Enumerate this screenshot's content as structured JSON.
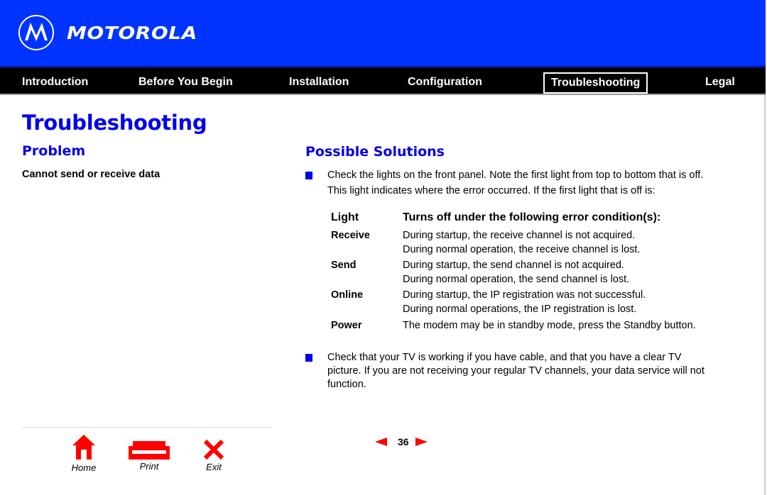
{
  "brand": {
    "name": "MOTOROLA",
    "logo_icon": "motorola-batwing-logo",
    "colors": {
      "brand_blue": "#0033ff",
      "nav_black": "#000000",
      "heading_blue": "#0000ee",
      "icon_red": "#ff0000"
    }
  },
  "nav": {
    "items": [
      {
        "label": "Introduction",
        "active": false
      },
      {
        "label": "Before You Begin",
        "active": false
      },
      {
        "label": "Installation",
        "active": false
      },
      {
        "label": "Configuration",
        "active": false
      },
      {
        "label": "Troubleshooting",
        "active": true
      },
      {
        "label": "Legal",
        "active": false
      }
    ]
  },
  "page": {
    "title": "Troubleshooting",
    "problem_heading": "Problem",
    "problem_text": "Cannot send or receive data",
    "solutions_heading": "Possible Solutions",
    "solutions": [
      {
        "lines": [
          "Check the lights on the front panel. Note the first light from top to bottom that is off.",
          "This light indicates where the error occurred. If the first light that is off is:"
        ]
      },
      {
        "lines": [
          "Check that your TV is working if you have cable, and that you have a clear TV",
          "picture. If you are not receiving your regular TV channels, your data service will not",
          "function."
        ]
      }
    ],
    "light_table": {
      "headers": [
        "Light",
        "Turns off under the following error condition(s):"
      ],
      "rows": [
        {
          "light": "Receive",
          "conditions": [
            "During startup, the receive channel is not acquired.",
            "During normal operation, the receive channel is lost."
          ]
        },
        {
          "light": "Send",
          "conditions": [
            "During startup, the send channel is not acquired.",
            "During normal operation, the send channel is lost."
          ]
        },
        {
          "light": "Online",
          "conditions": [
            "During startup, the IP registration was not successful.",
            "During normal operations, the IP registration is lost."
          ]
        },
        {
          "light": "Power",
          "conditions": [
            "The modem may be in standby mode, press the Standby button."
          ]
        }
      ]
    }
  },
  "footer": {
    "buttons": [
      {
        "label": "Home",
        "icon": "home-icon"
      },
      {
        "label": "Print",
        "icon": "print-icon"
      },
      {
        "label": "Exit",
        "icon": "exit-icon"
      }
    ],
    "page_number": "36",
    "prev_icon": "prev-page-arrow-icon",
    "next_icon": "next-page-arrow-icon"
  }
}
